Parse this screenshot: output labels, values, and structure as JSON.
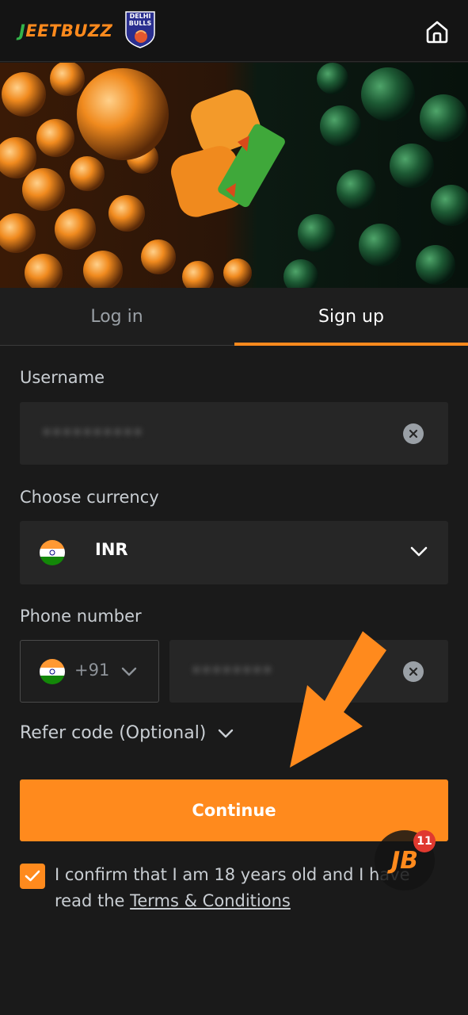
{
  "header": {
    "brand_name": "JeetBuzz",
    "brand_first": "J",
    "brand_rest": "EETBUZZ",
    "partner_badge": "DELHI BULLS",
    "home_icon": "home-icon"
  },
  "tabs": [
    {
      "label": "Log in",
      "active": false
    },
    {
      "label": "Sign up",
      "active": true
    }
  ],
  "form": {
    "username": {
      "label": "Username",
      "value": "••••••••••"
    },
    "currency": {
      "label": "Choose currency",
      "value": "INR"
    },
    "phone": {
      "label": "Phone number",
      "dial_code": "+91",
      "value": "••••••••"
    },
    "refer_label": "Refer code (Optional)",
    "continue_label": "Continue",
    "confirm_text": "I confirm that I am 18 years old and I have read the ",
    "terms_label": "Terms & Conditions",
    "confirm_checked": true
  },
  "chat": {
    "badge_count": "11",
    "logo": "JB"
  },
  "colors": {
    "accent": "#ff8a1d",
    "background": "#1a1a1a",
    "field": "#262626",
    "badge": "#e0392f"
  }
}
